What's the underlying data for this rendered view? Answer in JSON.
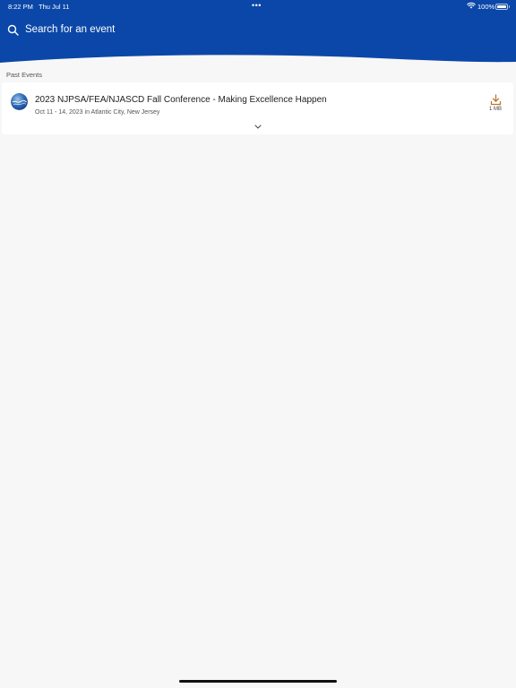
{
  "status_bar": {
    "time": "8:22 PM",
    "date": "Thu Jul 11",
    "dots": "•••",
    "battery": "100%"
  },
  "search": {
    "placeholder": "Search for an event"
  },
  "colors": {
    "header": "#0b47a8",
    "background": "#f7f7f7",
    "download_accent": "#c0732a"
  },
  "sections": {
    "past_events": {
      "title": "Past Events",
      "events": [
        {
          "title": "2023 NJPSA/FEA/NJASCD Fall Conference - Making Excellence Happen",
          "subtitle": "Oct 11 - 14, 2023 in Atlantic City, New Jersey",
          "download_size": "1 MB",
          "icons": [
            "event-logo",
            "download-icon",
            "chevron-down-icon"
          ]
        }
      ]
    }
  }
}
